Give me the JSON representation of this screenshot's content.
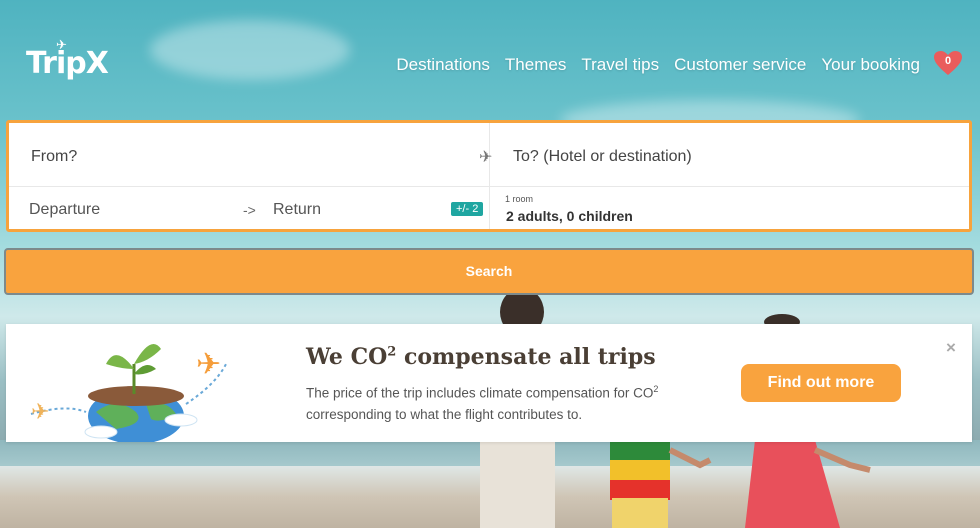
{
  "header": {
    "logo": "TripX",
    "nav": [
      "Destinations",
      "Themes",
      "Travel tips",
      "Customer service",
      "Your booking"
    ],
    "favorites_count": "0"
  },
  "search": {
    "from_placeholder": "From?",
    "to_placeholder": "To? (Hotel or destination)",
    "departure_placeholder": "Departure",
    "return_placeholder": "Return",
    "flex_days": "+/- 2",
    "room_label": "1 room",
    "guests": "2 adults,  0 children",
    "search_label": "Search"
  },
  "banner": {
    "title_prefix": "We CO",
    "title_sup": "2",
    "title_suffix": " compensate all trips",
    "text_a": "The price of the trip includes climate compensation for CO",
    "text_sup": "2",
    "text_b": "corresponding to what the flight contributes to.",
    "cta": "Find out more",
    "close": "×"
  },
  "colors": {
    "accent": "#f9a33e",
    "teal": "#1fa6a1"
  }
}
